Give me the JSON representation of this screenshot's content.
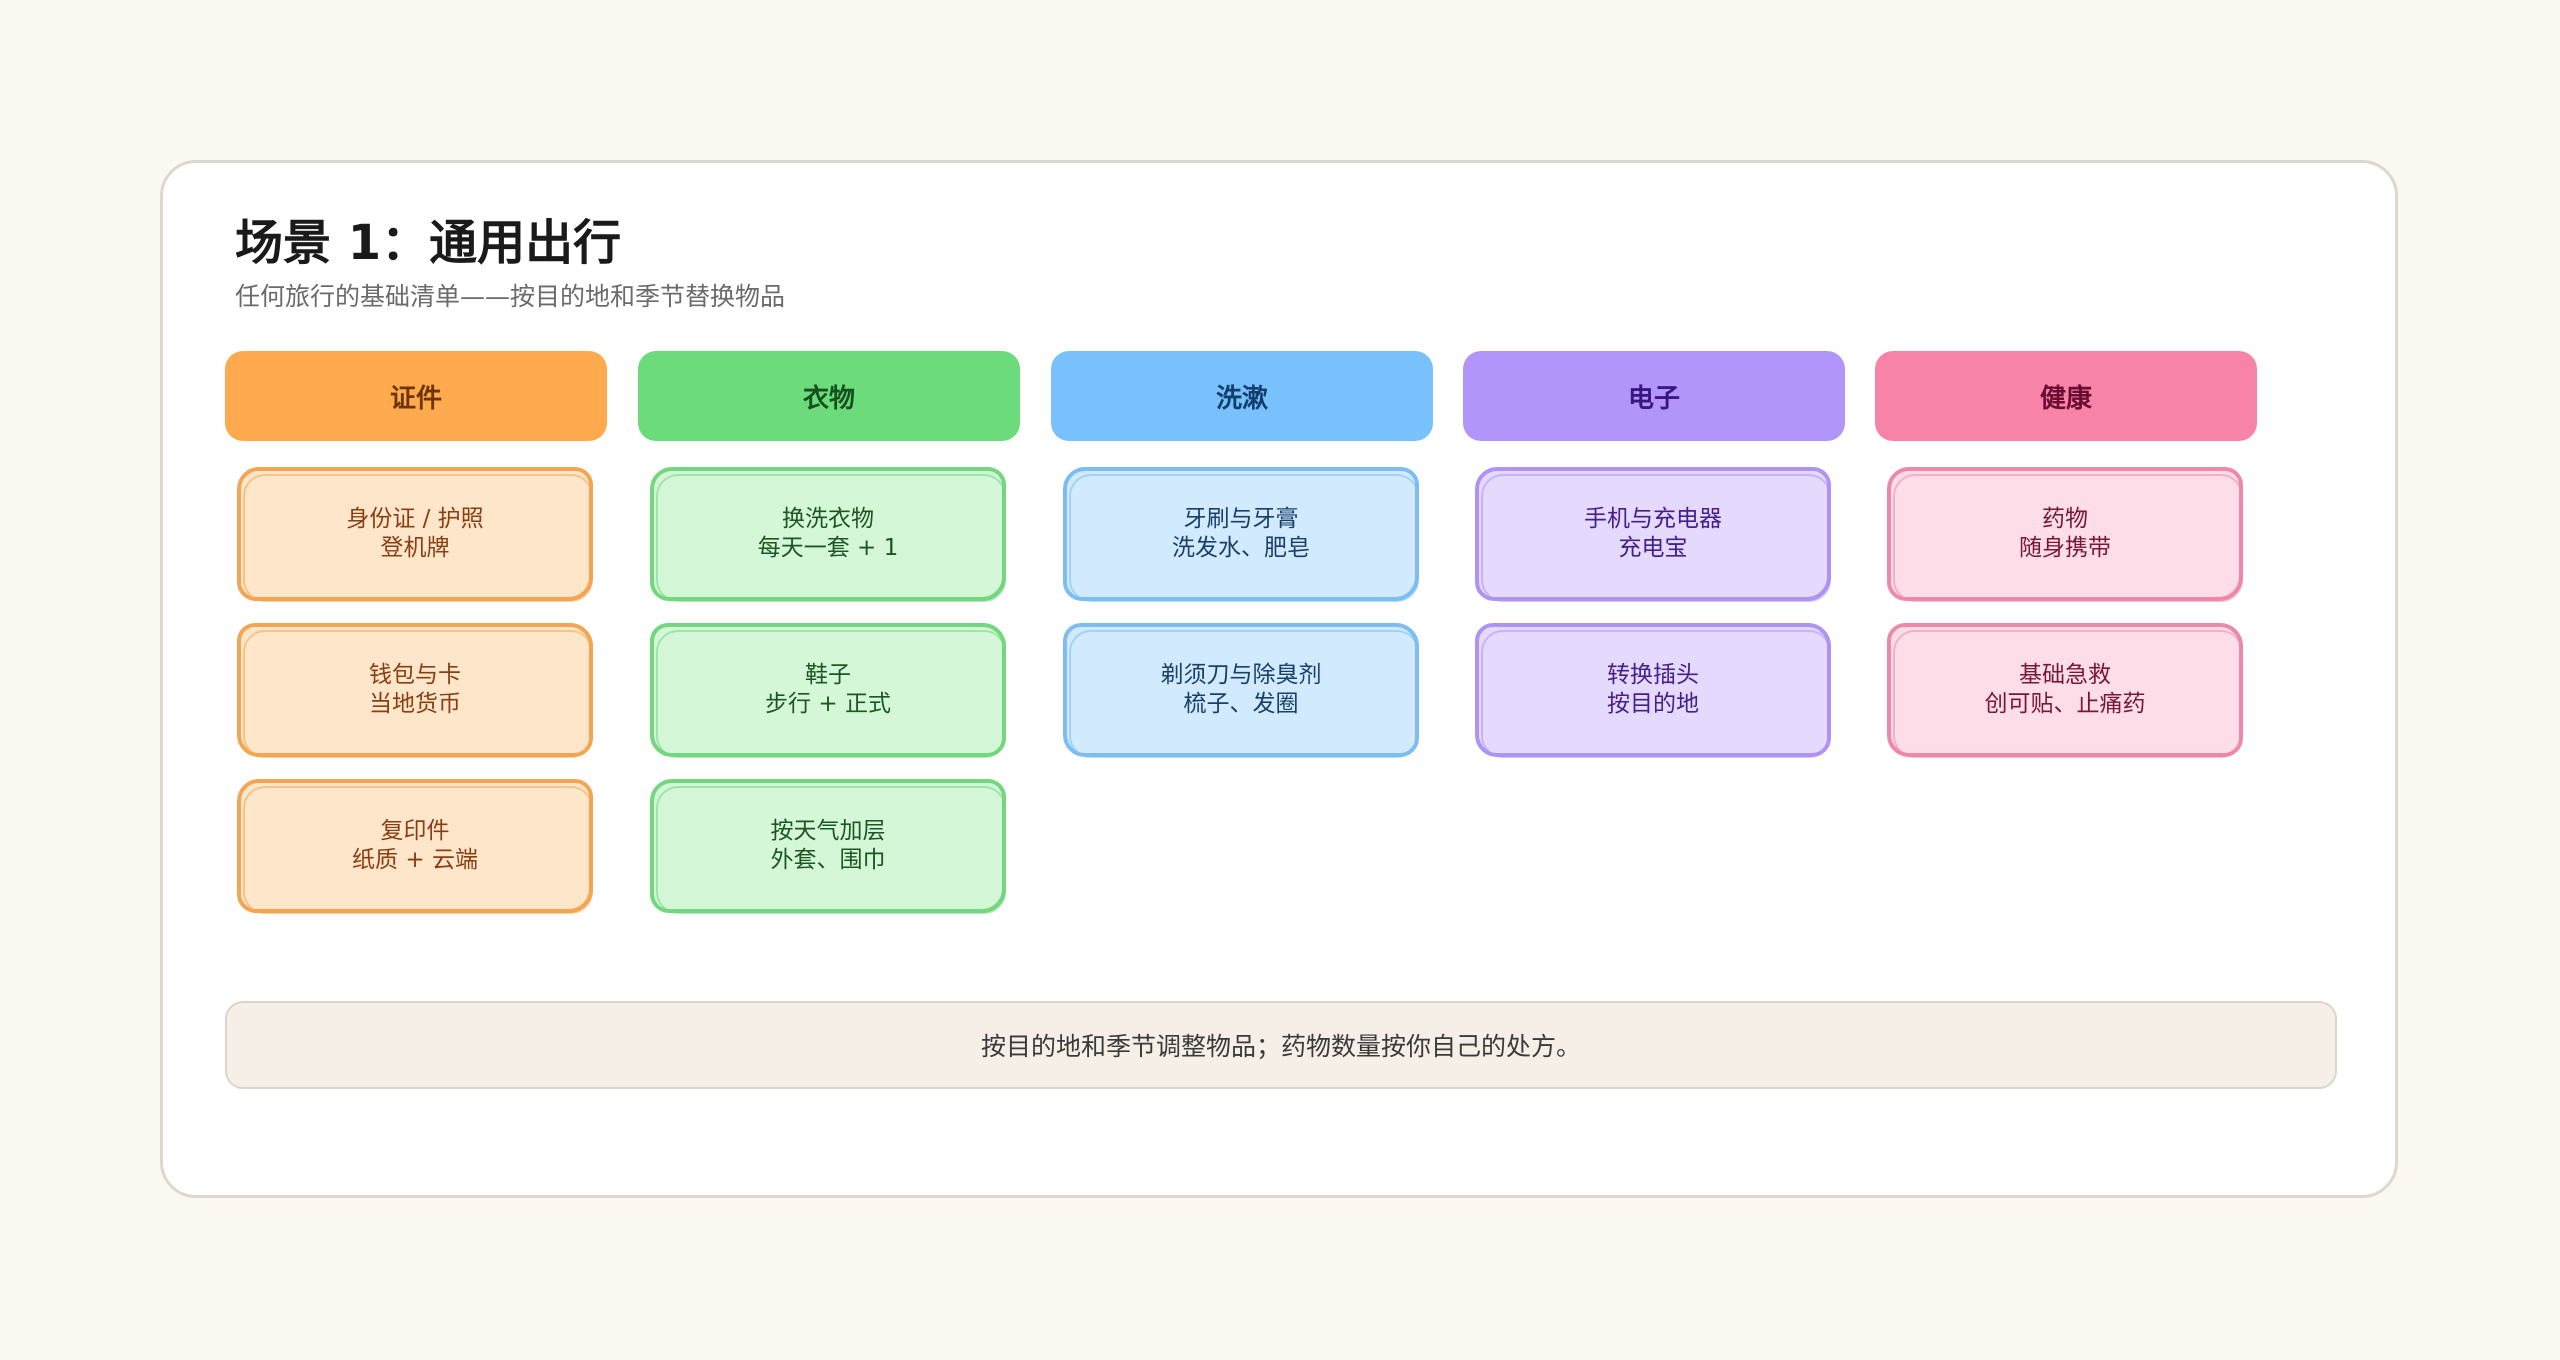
{
  "scene": {
    "title": "场景 1：通用出行",
    "subtitle": "任何旅行的基础清单——按目的地和季节替换物品"
  },
  "columns": [
    {
      "key": "docs",
      "header": "证件",
      "items": [
        {
          "line1": "身份证 / 护照",
          "line2": "登机牌"
        },
        {
          "line1": "钱包与卡",
          "line2": "当地货币"
        },
        {
          "line1": "复印件",
          "line2": "纸质 + 云端"
        }
      ]
    },
    {
      "key": "clothes",
      "header": "衣物",
      "items": [
        {
          "line1": "换洗衣物",
          "line2": "每天一套 + 1"
        },
        {
          "line1": "鞋子",
          "line2": "步行 + 正式"
        },
        {
          "line1": "按天气加层",
          "line2": "外套、围巾"
        }
      ]
    },
    {
      "key": "wash",
      "header": "洗漱",
      "items": [
        {
          "line1": "牙刷与牙膏",
          "line2": "洗发水、肥皂"
        },
        {
          "line1": "剃须刀与除臭剂",
          "line2": "梳子、发圈"
        }
      ]
    },
    {
      "key": "elec",
      "header": "电子",
      "items": [
        {
          "line1": "手机与充电器",
          "line2": "充电宝"
        },
        {
          "line1": "转换插头",
          "line2": "按目的地"
        }
      ]
    },
    {
      "key": "health",
      "header": "健康",
      "items": [
        {
          "line1": "药物",
          "line2": "随身携带"
        },
        {
          "line1": "基础急救",
          "line2": "创可贴、止痛药"
        }
      ]
    }
  ],
  "note": "按目的地和季节调整物品；药物数量按你自己的处方。",
  "colors": {
    "docs": "#ffaa4e",
    "clothes": "#6bdb7c",
    "wash": "#79c1fc",
    "elec": "#b195fb",
    "health": "#f783a9"
  }
}
